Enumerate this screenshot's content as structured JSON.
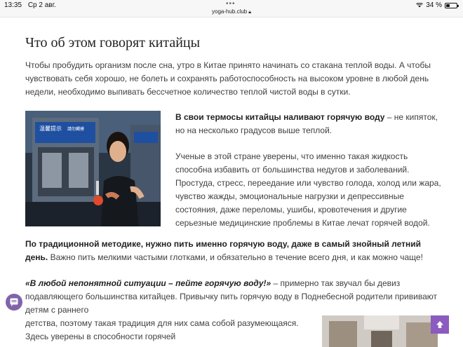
{
  "status_bar": {
    "time": "13:35",
    "date": "Ср 2 авг.",
    "dots": "•••",
    "url": "yoga-hub.club",
    "battery_percent": "34 %",
    "battery_level": 0.34
  },
  "article": {
    "heading": "Что об этом говорят китайцы",
    "intro": "Чтобы пробудить организм после сна, утро в Китае принято начинать со стакана теплой воды. А чтобы чувствовать себя хорошо, не болеть и сохранять работоспособность на высоком уровне в любой день недели, необходимо выпивать бессчетное количество теплой чистой воды в сутки.",
    "right_p1_bold": "В свои термосы китайцы наливают горячую воду",
    "right_p1_rest": " – не кипяток, но на несколько градусов выше теплой.",
    "right_p2": "Ученые в этой стране уверены, что именно такая жидкость способна избавить от большинства недугов и заболеваний. Простуда, стресс, переедание или чувство голода, холод или жара, чувство жажды, эмоциональные нагрузки и депрессивные состояния, даже переломы, ушибы, кровотечения и другие серьезные медицинские проблемы в Китае лечат горячей водой.",
    "full_p1_bold": "По традиционной методике, нужно пить именно горячую воду, даже в самый знойный летний день.",
    "full_p1_rest": " Важно пить мелкими частыми глотками, и обязательно в течение всего дня, и как можно чаще!",
    "quote": "«В любой непонятной ситуации – пейте горячую воду!»",
    "full_p2_rest": " – примерно так звучал бы девиз подавляющего большинства китайцев. Привычку пить горячую воду в Поднебесной родители прививают детям с раннего",
    "bottom_p": "детства, поэтому такая традиция для них сама собой разумеющаяся. Здесь уверены в способности горячей"
  },
  "photo": {
    "machine_sign_line1": "温馨提示",
    "machine_sign_line2": "請勿觸摸"
  },
  "icons": {
    "chat": "chat-icon",
    "scroll_up": "arrow-up-icon"
  },
  "colors": {
    "accent_purple": "#8c5bbf",
    "chat_purple": "#8064a8"
  }
}
